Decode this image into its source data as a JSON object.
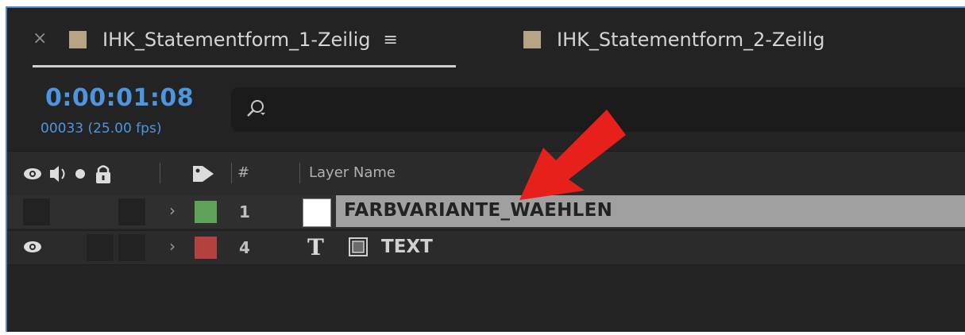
{
  "tabs": [
    {
      "close": "×",
      "label": "IHK_Statementform_1-Zeilig",
      "menu": "≡",
      "active": true
    },
    {
      "label": "IHK_Statementform_2-Zeilig",
      "active": false
    }
  ],
  "time": {
    "timecode": "0:00:01:08",
    "frames": "00033 (25.00 fps)"
  },
  "columns": {
    "number": "#",
    "layer_name": "Layer Name"
  },
  "layers": [
    {
      "chevron": "›",
      "number": "1",
      "label_color": "#5ea25a",
      "name": "FARBVARIANTE_WAEHLEN",
      "selected": true
    },
    {
      "chevron": "›",
      "number": "4",
      "label_color": "#b54040",
      "type_glyph": "T",
      "name": "TEXT",
      "selected": false
    }
  ],
  "colors": {
    "accent": "#4e95e0",
    "annotation_arrow": "#e8201c"
  }
}
